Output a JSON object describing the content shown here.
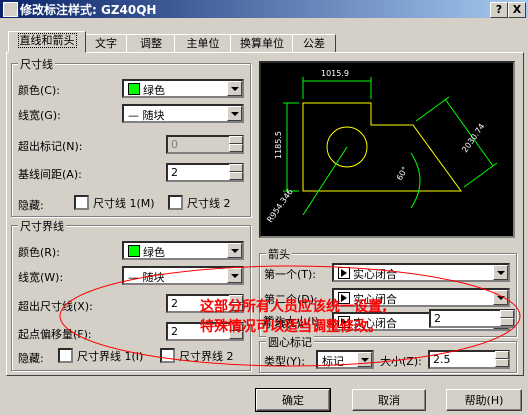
{
  "window": {
    "title": "修改标注样式: GZ40QH",
    "help_btn": "?",
    "close_btn": "X"
  },
  "tabs": [
    "直线和箭头",
    "文字",
    "调整",
    "主单位",
    "换算单位",
    "公差"
  ],
  "dim_line": {
    "legend": "尺寸线",
    "color_label": "颜色(C):",
    "color_value": "绿色",
    "lineweight_label": "线宽(G):",
    "lineweight_value": "— 随块",
    "extend_ticks_label": "超出标记(N):",
    "extend_ticks_value": "0",
    "baseline_label": "基线间距(A):",
    "baseline_value": "2",
    "suppress_label": "隐藏:",
    "suppress_1": "尺寸线 1(M)",
    "suppress_2": "尺寸线 2"
  },
  "ext_line": {
    "legend": "尺寸界线",
    "color_label": "颜色(R):",
    "color_value": "绿色",
    "lineweight_label": "线宽(W):",
    "lineweight_value": "— 随块",
    "extend_label": "超出尺寸线(X):",
    "extend_value": "2",
    "offset_label": "起点偏移量(F):",
    "offset_value": "2",
    "suppress_label": "隐藏:",
    "suppress_1": "尺寸界线 1(I)",
    "suppress_2": "尺寸界线 2"
  },
  "arrows": {
    "legend": "箭头",
    "first_label": "第一个(T):",
    "first_value": "实心闭合",
    "second_label": "第二个(D):",
    "second_value": "实心闭合",
    "leader_label": "引线(L):",
    "leader_value": "实心闭合",
    "size_label": "箭头大小(I):",
    "size_value": "2"
  },
  "center_marks": {
    "legend": "圆心标记",
    "type_label": "类型(Y):",
    "type_value": "标记",
    "size_label": "大小(Z):",
    "size_value": "2.5"
  },
  "preview": {
    "dim_top": "1015.9",
    "dim_left": "1185.5",
    "dim_right": "2030.74",
    "dim_angle": "60°",
    "dim_radius": "R954.346"
  },
  "annotation": {
    "line1": "这部分所有人员应该统一设置,",
    "line2": "特殊情况可以适当调整修改。"
  },
  "buttons": {
    "ok": "确定",
    "cancel": "取消",
    "help": "帮助(H)"
  },
  "colors": {
    "titlebar": "#0a246a",
    "swatch_green": "#00ff00",
    "annotation_red": "#ff0000",
    "preview_line": "#ffff00",
    "preview_dim": "#00ff00"
  }
}
